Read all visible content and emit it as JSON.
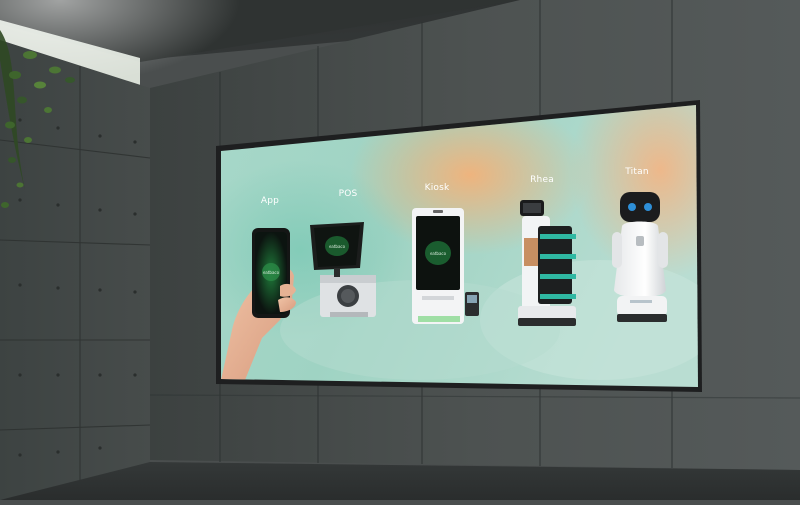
{
  "display": {
    "products": [
      {
        "label": "App",
        "icon": "smartphone-icon"
      },
      {
        "label": "POS",
        "icon": "pos-terminal-icon"
      },
      {
        "label": "Kiosk",
        "icon": "kiosk-icon"
      },
      {
        "label": "Rhea",
        "icon": "delivery-robot-icon"
      },
      {
        "label": "Titan",
        "icon": "service-robot-icon"
      }
    ],
    "device_logo": "eatbaco"
  },
  "colors": {
    "wall": "#4a4e4e",
    "screen_teal": "#9fd6c6",
    "screen_orange": "#f2b27a",
    "frame": "#1e1f20"
  }
}
